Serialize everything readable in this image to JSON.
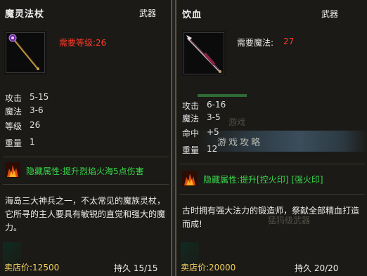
{
  "left": {
    "name": "魔灵法杖",
    "type": "武器",
    "requirement": "需要等级:26",
    "stats": [
      {
        "label": "攻击",
        "value": "5-15"
      },
      {
        "label": "魔法",
        "value": "3-6"
      },
      {
        "label": "等级",
        "value": "26"
      },
      {
        "label": "重量",
        "value": "1"
      }
    ],
    "hidden_attr": "隐藏属性:提升烈焰火海5点伤害",
    "description": "海岛三大神兵之一，不太常见的魔族灵杖，它所寻的主人要具有敏锐的直觉和强大的魔力。",
    "price": "卖店价:12500",
    "durability": "持久 15/15",
    "icon": "magic-staff-icon"
  },
  "right": {
    "name": "饮血",
    "type": "武器",
    "requirement_label": "需要魔法:",
    "requirement_value": "27",
    "stats": [
      {
        "label": "攻击",
        "value": "6-16"
      },
      {
        "label": "魔法",
        "value": "3-5"
      },
      {
        "label": "命中",
        "value": "+5"
      },
      {
        "label": "重量",
        "value": "12"
      }
    ],
    "hidden_attr": "隐藏属性:提升[控火印] [强火印]",
    "description": "古时拥有强大法力的锻造师，祭献全部精血打造而成!",
    "price": "卖店价:20000",
    "durability": "持久 20/20",
    "icon": "blood-spear-icon",
    "watermark_top": "游戏",
    "watermark_banner": "游戏攻略",
    "watermark_bottom": "猛犸级武器"
  },
  "colors": {
    "requirement_red": "#ff3a2a",
    "hidden_green": "#39d84b",
    "footer_gold": "#f0d060"
  }
}
